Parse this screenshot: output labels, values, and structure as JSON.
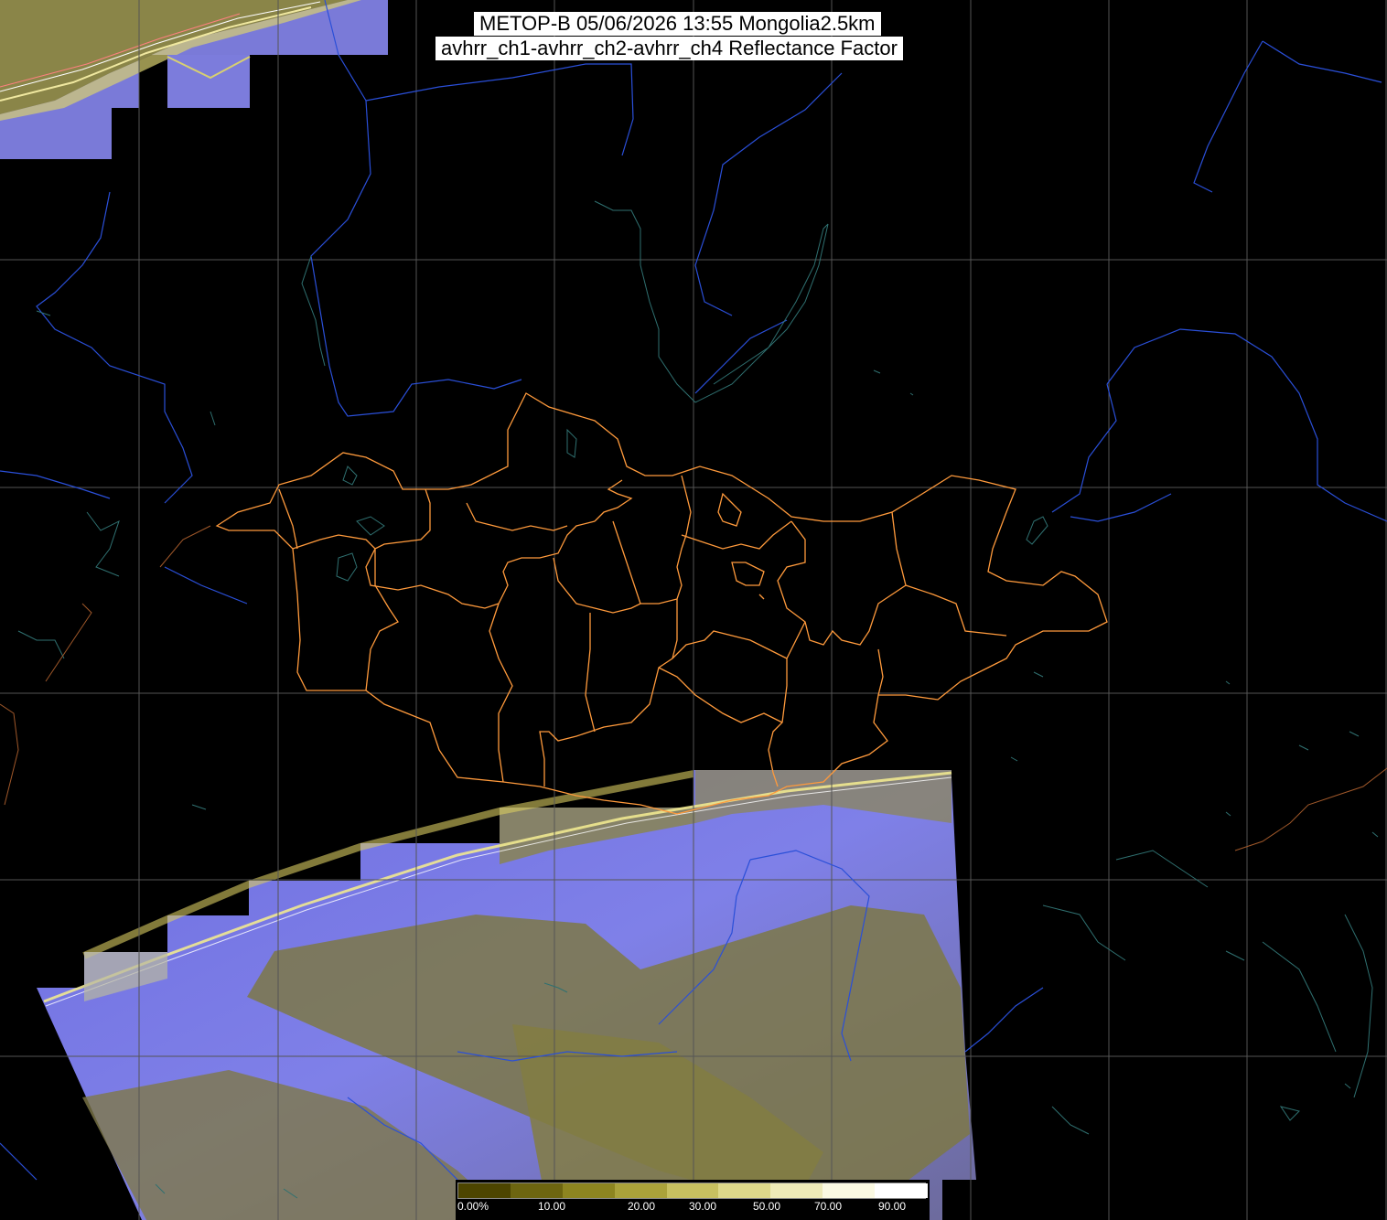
{
  "title": {
    "line1": "METOP-B 05/06/2026 13:55 Mongolia2.5km",
    "line2": "avhrr_ch1-avhrr_ch2-avhrr_ch4 Reflectance Factor"
  },
  "colorbar": {
    "labels": [
      "0.00%",
      "10.00",
      "20.00",
      "30.00",
      "50.00",
      "70.00",
      "90.00"
    ],
    "colors": [
      "#4d4500",
      "#6d6510",
      "#8d8520",
      "#aaa23a",
      "#c7c060",
      "#ddd88a",
      "#eeeab8",
      "#fbf9e2",
      "#ffffff"
    ]
  },
  "colors": {
    "background": "#000000",
    "graticule": "#555555",
    "coastline": "#2a4fd8",
    "lakes": "#2f6f6f",
    "admin_border": "#ff9a3c",
    "cloud": "#7a7ae6",
    "ground": "#7a7440"
  }
}
